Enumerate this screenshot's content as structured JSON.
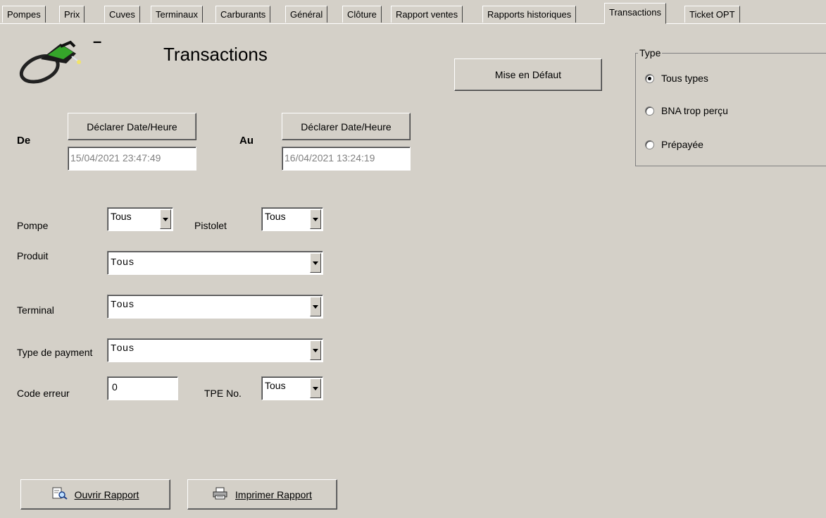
{
  "tabs": [
    {
      "label": "Pompes"
    },
    {
      "label": "Prix"
    },
    {
      "label": "Cuves"
    },
    {
      "label": "Terminaux"
    },
    {
      "label": "Carburants"
    },
    {
      "label": "Général"
    },
    {
      "label": "Clôture"
    },
    {
      "label": "Rapport ventes"
    },
    {
      "label": "Rapports historiques"
    },
    {
      "label": "Transactions"
    },
    {
      "label": "Ticket OPT"
    }
  ],
  "header": {
    "title": "Transactions",
    "dash": "–",
    "icon": "fuel-nozzle-icon"
  },
  "default_button": "Mise en Défaut",
  "date_from": {
    "label": "De",
    "button": "Déclarer Date/Heure",
    "value": "15/04/2021  23:47:49"
  },
  "date_to": {
    "label": "Au",
    "button": "Déclarer Date/Heure",
    "value": "16/04/2021  13:24:19"
  },
  "type_group": {
    "title": "Type",
    "options": [
      {
        "label": "Tous types",
        "checked": true
      },
      {
        "label": "BNA trop perçu",
        "checked": false
      },
      {
        "label": "Prépayée",
        "checked": false
      }
    ]
  },
  "filters": {
    "pompe": {
      "label": "Pompe",
      "value": "Tous"
    },
    "pistolet": {
      "label": "Pistolet",
      "value": "Tous"
    },
    "produit": {
      "label": "Produit",
      "value": "Tous"
    },
    "terminal": {
      "label": "Terminal",
      "value": "Tous"
    },
    "type_payment": {
      "label": "Type de payment",
      "value": "Tous"
    },
    "code_erreur": {
      "label": "Code erreur",
      "value": "0"
    },
    "tpe": {
      "label": "TPE No.",
      "value": "Tous"
    }
  },
  "actions": {
    "open_report": {
      "label": "Ouvrir Rapport",
      "icon": "preview-report-icon"
    },
    "print_report": {
      "label": "Imprimer Rapport",
      "icon": "printer-icon"
    }
  }
}
